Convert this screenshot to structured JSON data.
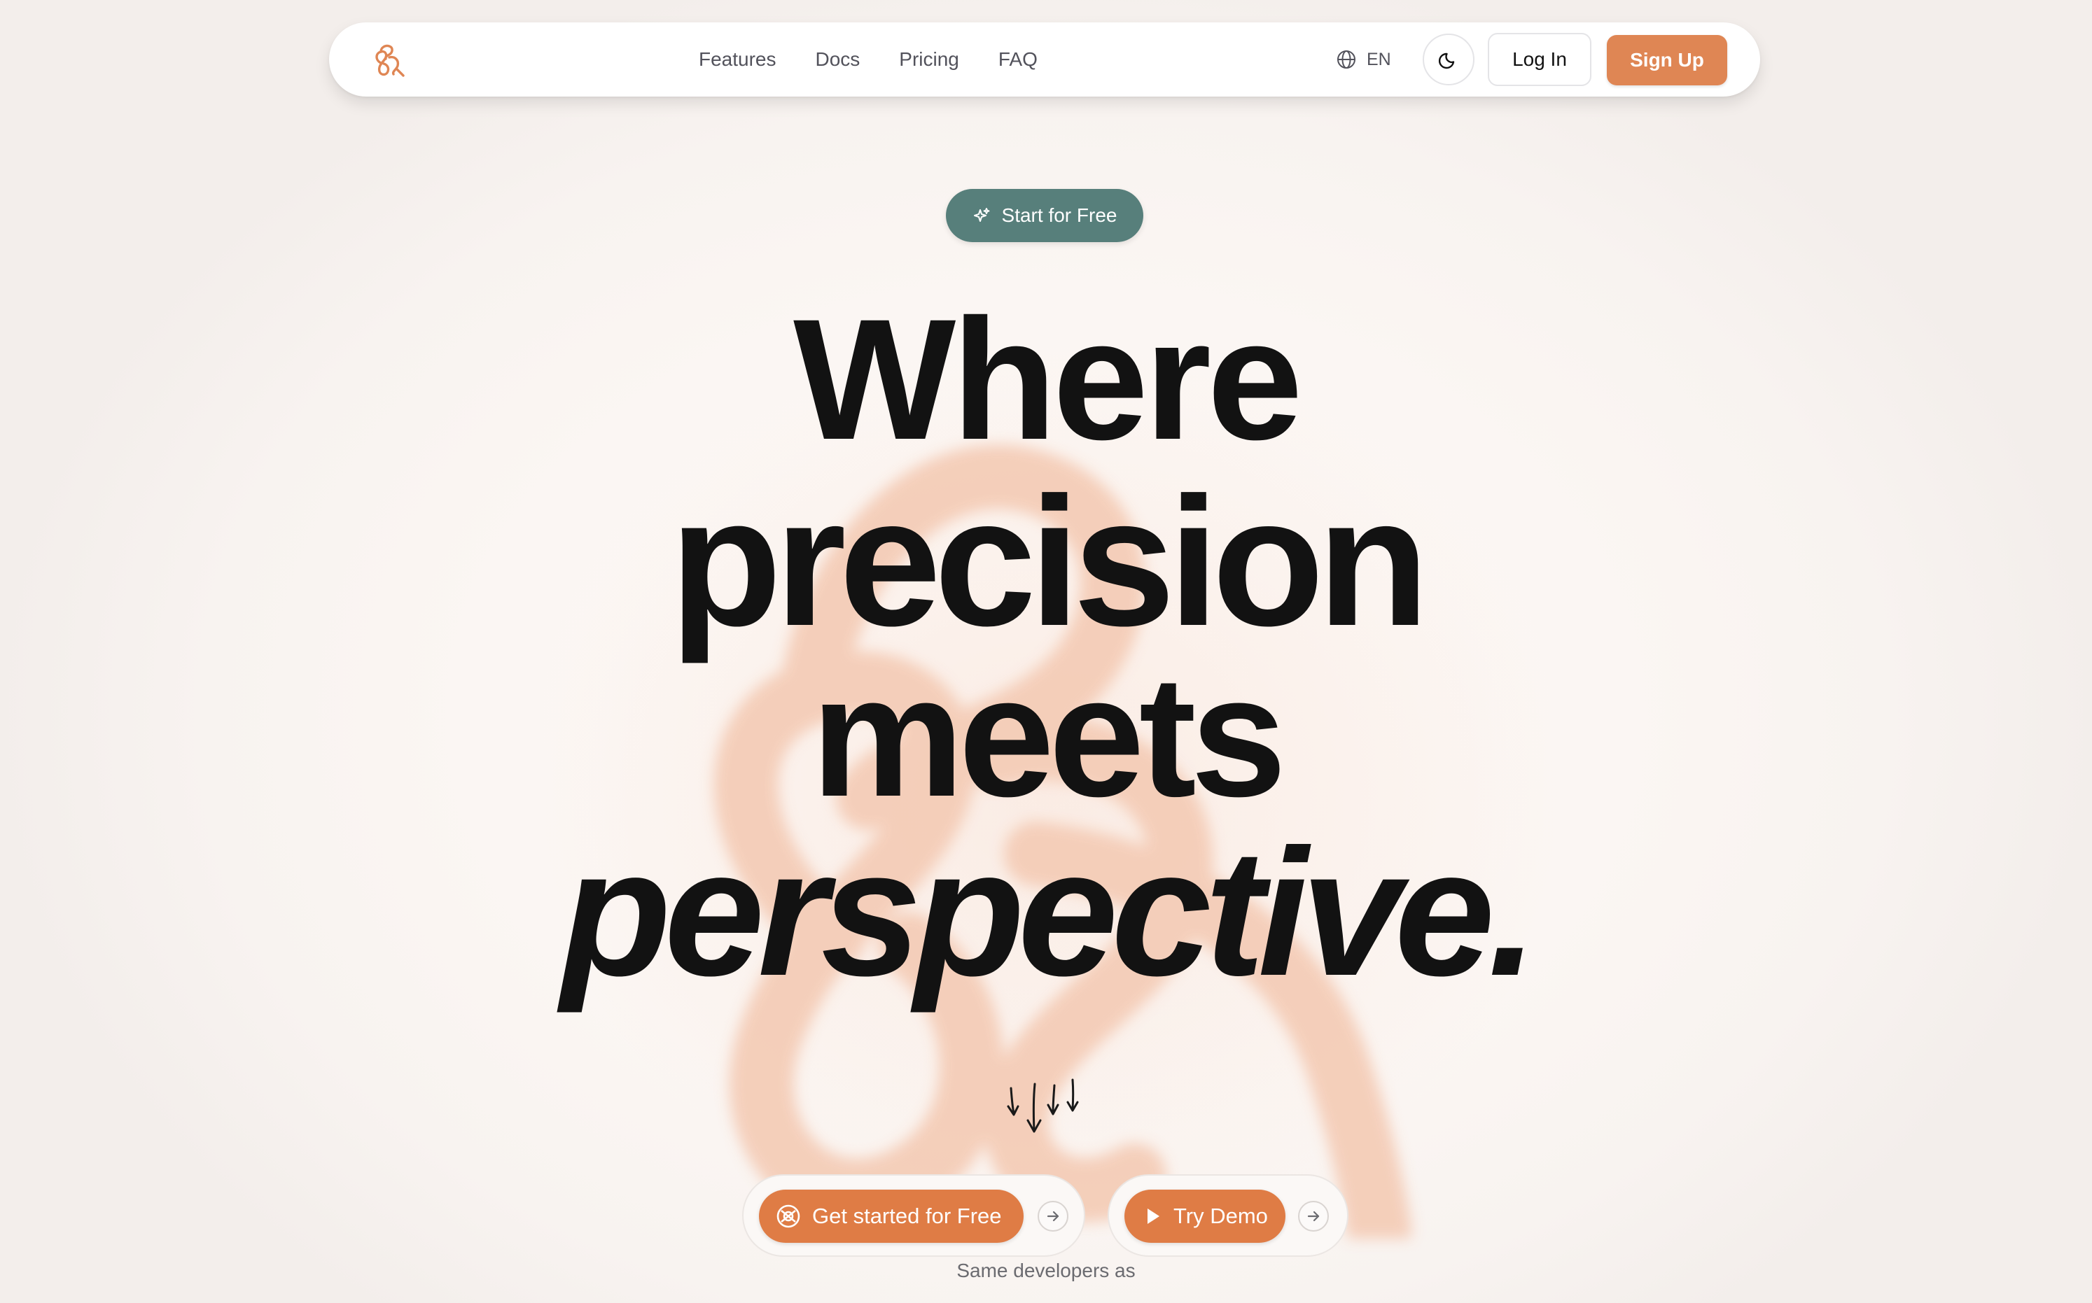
{
  "nav": {
    "logo_icon": "knot-logo-icon",
    "links": [
      "Features",
      "Docs",
      "Pricing",
      "FAQ"
    ],
    "language_icon": "globe-icon",
    "language": "EN",
    "theme_icon": "moon-icon",
    "login_label": "Log In",
    "signup_label": "Sign Up"
  },
  "hero": {
    "badge_icon": "sparkle-icon",
    "badge_label": "Start for Free",
    "headline": [
      "Where",
      "precision",
      "meets",
      "perspective."
    ],
    "scroll_icon": "hand-drawn-down-arrows-icon"
  },
  "cta": {
    "primary_icon": "logo-circle-icon",
    "primary_label": "Get started for Free",
    "secondary_icon": "play-icon",
    "secondary_label": "Try Demo",
    "arrow_icon": "arrow-right-icon"
  },
  "footnote": "Same developers as",
  "colors": {
    "accent": "#df8654",
    "accent_cta": "#df7c45",
    "badge": "#577f7b",
    "background": "#fcf9f7",
    "headline": "#121212",
    "background_mark": "#f4cbb5"
  }
}
